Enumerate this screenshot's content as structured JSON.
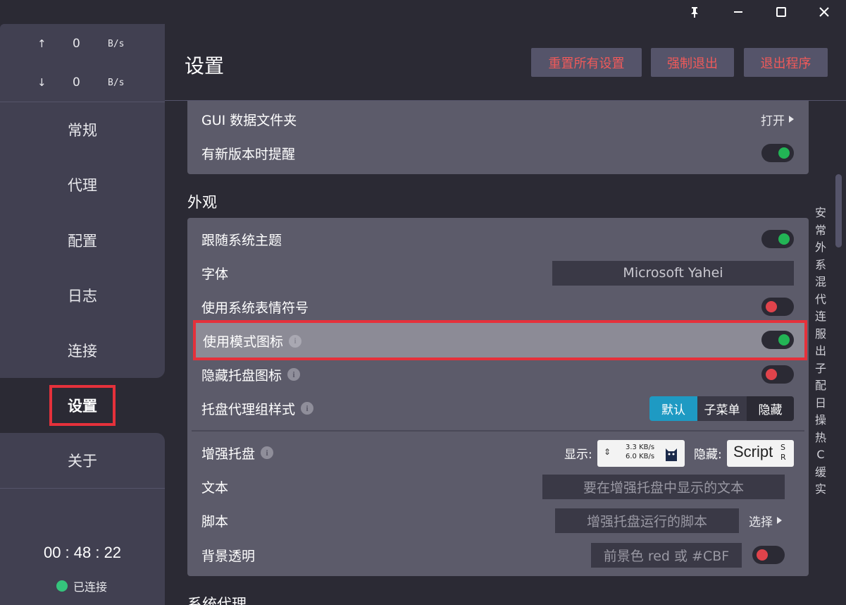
{
  "titlebar": {
    "pin": "📌",
    "minimize": "",
    "maximize": "",
    "close": "✕"
  },
  "traffic": {
    "up": {
      "arrow": "↑",
      "value": "0",
      "unit": "B/s"
    },
    "down": {
      "arrow": "↓",
      "value": "0",
      "unit": "B/s"
    }
  },
  "nav": {
    "items": [
      "常规",
      "代理",
      "配置",
      "日志",
      "连接"
    ],
    "active": "设置",
    "about": "关于"
  },
  "status": {
    "timer": "00 : 48 : 22",
    "connection": "已连接"
  },
  "header": {
    "title": "设置",
    "buttons": [
      "重置所有设置",
      "强制退出",
      "退出程序"
    ]
  },
  "general": {
    "gui_folder": {
      "label": "GUI 数据文件夹",
      "action": "打开"
    },
    "update_notify": {
      "label": "有新版本时提醒",
      "state": "on"
    }
  },
  "appearance": {
    "title": "外观",
    "follow_theme": {
      "label": "跟随系统主题",
      "state": "on"
    },
    "font": {
      "label": "字体",
      "value": "Microsoft Yahei"
    },
    "system_emoji": {
      "label": "使用系统表情符号",
      "state": "off"
    },
    "mode_icon": {
      "label": "使用模式图标",
      "state": "on"
    },
    "hide_tray": {
      "label": "隐藏托盘图标",
      "state": "off"
    },
    "tray_proxy_style": {
      "label": "托盘代理组样式",
      "options": [
        "默认",
        "子菜单",
        "隐藏"
      ],
      "selected": "默认"
    },
    "enhanced_tray": {
      "label": "增强托盘",
      "display_label": "显示:",
      "preview_up": "3.3 KB/s",
      "preview_down": "6.0 KB/s",
      "hide_label": "隐藏:",
      "script_label": "Script",
      "script_sub_top": "S",
      "script_sub_bottom": "R"
    },
    "text": {
      "label": "文本",
      "placeholder": "要在增强托盘中显示的文本"
    },
    "script": {
      "label": "脚本",
      "placeholder": "增强托盘运行的脚本",
      "action": "选择"
    },
    "bg_transparent": {
      "label": "背景透明",
      "placeholder": "前景色 red 或 #CBF",
      "state": "off"
    }
  },
  "next_section": {
    "title": "系统代理"
  },
  "index_letters": [
    "安",
    "常",
    "外",
    "系",
    "混",
    "代",
    "连",
    "服",
    "出",
    "子",
    "配",
    "日",
    "操",
    "热",
    "C",
    "缓",
    "实"
  ],
  "colors": {
    "accent": "#1e9ac3",
    "danger": "#f05a5a",
    "toggle_on": "#22b455",
    "toggle_off": "#e0434b",
    "connected": "#35c47c",
    "highlight_border": "#e5313b"
  }
}
